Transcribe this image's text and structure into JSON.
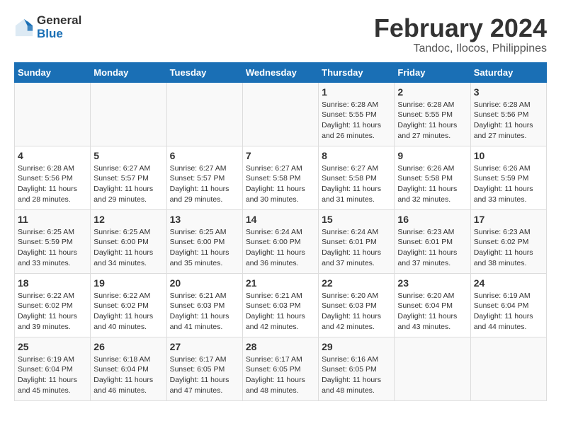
{
  "header": {
    "logo_line1": "General",
    "logo_line2": "Blue",
    "main_title": "February 2024",
    "subtitle": "Tandoc, Ilocos, Philippines"
  },
  "calendar": {
    "days_of_week": [
      "Sunday",
      "Monday",
      "Tuesday",
      "Wednesday",
      "Thursday",
      "Friday",
      "Saturday"
    ],
    "weeks": [
      [
        {
          "day": "",
          "info": ""
        },
        {
          "day": "",
          "info": ""
        },
        {
          "day": "",
          "info": ""
        },
        {
          "day": "",
          "info": ""
        },
        {
          "day": "1",
          "info": "Sunrise: 6:28 AM\nSunset: 5:55 PM\nDaylight: 11 hours and 26 minutes."
        },
        {
          "day": "2",
          "info": "Sunrise: 6:28 AM\nSunset: 5:55 PM\nDaylight: 11 hours and 27 minutes."
        },
        {
          "day": "3",
          "info": "Sunrise: 6:28 AM\nSunset: 5:56 PM\nDaylight: 11 hours and 27 minutes."
        }
      ],
      [
        {
          "day": "4",
          "info": "Sunrise: 6:28 AM\nSunset: 5:56 PM\nDaylight: 11 hours and 28 minutes."
        },
        {
          "day": "5",
          "info": "Sunrise: 6:27 AM\nSunset: 5:57 PM\nDaylight: 11 hours and 29 minutes."
        },
        {
          "day": "6",
          "info": "Sunrise: 6:27 AM\nSunset: 5:57 PM\nDaylight: 11 hours and 29 minutes."
        },
        {
          "day": "7",
          "info": "Sunrise: 6:27 AM\nSunset: 5:58 PM\nDaylight: 11 hours and 30 minutes."
        },
        {
          "day": "8",
          "info": "Sunrise: 6:27 AM\nSunset: 5:58 PM\nDaylight: 11 hours and 31 minutes."
        },
        {
          "day": "9",
          "info": "Sunrise: 6:26 AM\nSunset: 5:58 PM\nDaylight: 11 hours and 32 minutes."
        },
        {
          "day": "10",
          "info": "Sunrise: 6:26 AM\nSunset: 5:59 PM\nDaylight: 11 hours and 33 minutes."
        }
      ],
      [
        {
          "day": "11",
          "info": "Sunrise: 6:25 AM\nSunset: 5:59 PM\nDaylight: 11 hours and 33 minutes."
        },
        {
          "day": "12",
          "info": "Sunrise: 6:25 AM\nSunset: 6:00 PM\nDaylight: 11 hours and 34 minutes."
        },
        {
          "day": "13",
          "info": "Sunrise: 6:25 AM\nSunset: 6:00 PM\nDaylight: 11 hours and 35 minutes."
        },
        {
          "day": "14",
          "info": "Sunrise: 6:24 AM\nSunset: 6:00 PM\nDaylight: 11 hours and 36 minutes."
        },
        {
          "day": "15",
          "info": "Sunrise: 6:24 AM\nSunset: 6:01 PM\nDaylight: 11 hours and 37 minutes."
        },
        {
          "day": "16",
          "info": "Sunrise: 6:23 AM\nSunset: 6:01 PM\nDaylight: 11 hours and 37 minutes."
        },
        {
          "day": "17",
          "info": "Sunrise: 6:23 AM\nSunset: 6:02 PM\nDaylight: 11 hours and 38 minutes."
        }
      ],
      [
        {
          "day": "18",
          "info": "Sunrise: 6:22 AM\nSunset: 6:02 PM\nDaylight: 11 hours and 39 minutes."
        },
        {
          "day": "19",
          "info": "Sunrise: 6:22 AM\nSunset: 6:02 PM\nDaylight: 11 hours and 40 minutes."
        },
        {
          "day": "20",
          "info": "Sunrise: 6:21 AM\nSunset: 6:03 PM\nDaylight: 11 hours and 41 minutes."
        },
        {
          "day": "21",
          "info": "Sunrise: 6:21 AM\nSunset: 6:03 PM\nDaylight: 11 hours and 42 minutes."
        },
        {
          "day": "22",
          "info": "Sunrise: 6:20 AM\nSunset: 6:03 PM\nDaylight: 11 hours and 42 minutes."
        },
        {
          "day": "23",
          "info": "Sunrise: 6:20 AM\nSunset: 6:04 PM\nDaylight: 11 hours and 43 minutes."
        },
        {
          "day": "24",
          "info": "Sunrise: 6:19 AM\nSunset: 6:04 PM\nDaylight: 11 hours and 44 minutes."
        }
      ],
      [
        {
          "day": "25",
          "info": "Sunrise: 6:19 AM\nSunset: 6:04 PM\nDaylight: 11 hours and 45 minutes."
        },
        {
          "day": "26",
          "info": "Sunrise: 6:18 AM\nSunset: 6:04 PM\nDaylight: 11 hours and 46 minutes."
        },
        {
          "day": "27",
          "info": "Sunrise: 6:17 AM\nSunset: 6:05 PM\nDaylight: 11 hours and 47 minutes."
        },
        {
          "day": "28",
          "info": "Sunrise: 6:17 AM\nSunset: 6:05 PM\nDaylight: 11 hours and 48 minutes."
        },
        {
          "day": "29",
          "info": "Sunrise: 6:16 AM\nSunset: 6:05 PM\nDaylight: 11 hours and 48 minutes."
        },
        {
          "day": "",
          "info": ""
        },
        {
          "day": "",
          "info": ""
        }
      ]
    ]
  }
}
